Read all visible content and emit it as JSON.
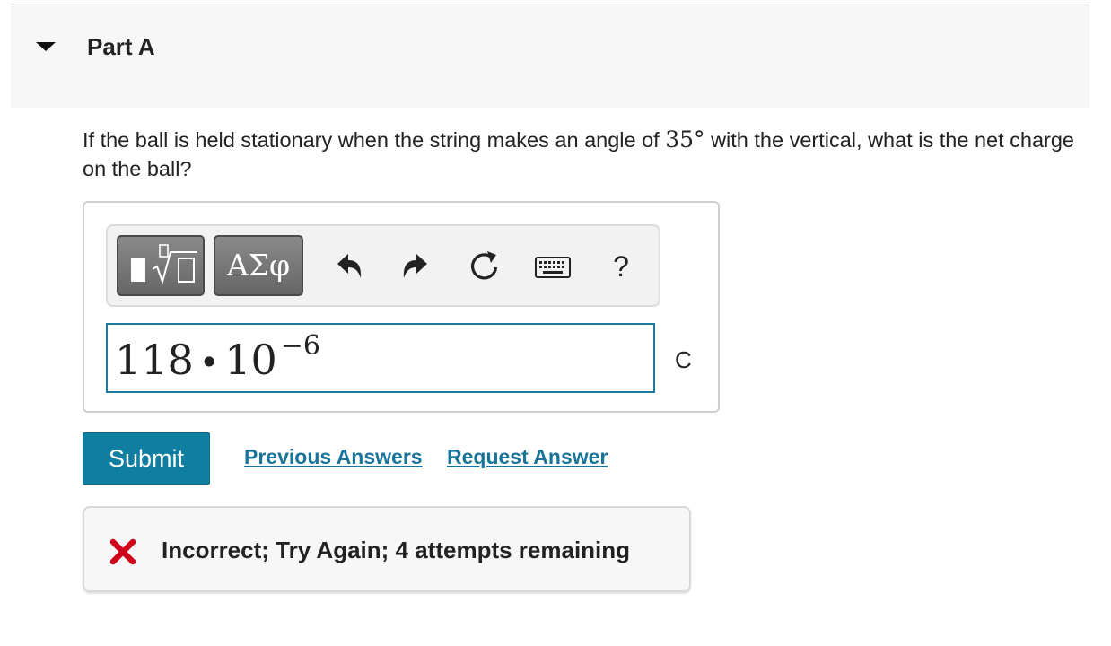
{
  "part": {
    "title": "Part A"
  },
  "question": {
    "text_before": "If the ball is held stationary when the string makes an angle of ",
    "angle": "35°",
    "text_after": " with the vertical, what is the net charge on the ball?"
  },
  "toolbar": {
    "templates_icon": "templates-radical-icon",
    "symbols_label": "ΑΣφ",
    "undo_icon": "undo-icon",
    "redo_icon": "redo-icon",
    "reset_icon": "reset-icon",
    "keyboard_icon": "keyboard-icon",
    "help_label": "?"
  },
  "answer": {
    "mantissa": "118",
    "operator": "•",
    "base": "10",
    "exponent": "−6",
    "unit": "C"
  },
  "actions": {
    "submit_label": "Submit",
    "previous_answers_label": "Previous Answers",
    "request_answer_label": "Request Answer"
  },
  "feedback": {
    "icon": "x-mark-icon",
    "text": "Incorrect; Try Again; 4 attempts remaining",
    "icon_color": "#d0021b"
  },
  "colors": {
    "accent": "#0f7ea1",
    "link": "#1a7399",
    "input_border": "#1a7d9b"
  }
}
